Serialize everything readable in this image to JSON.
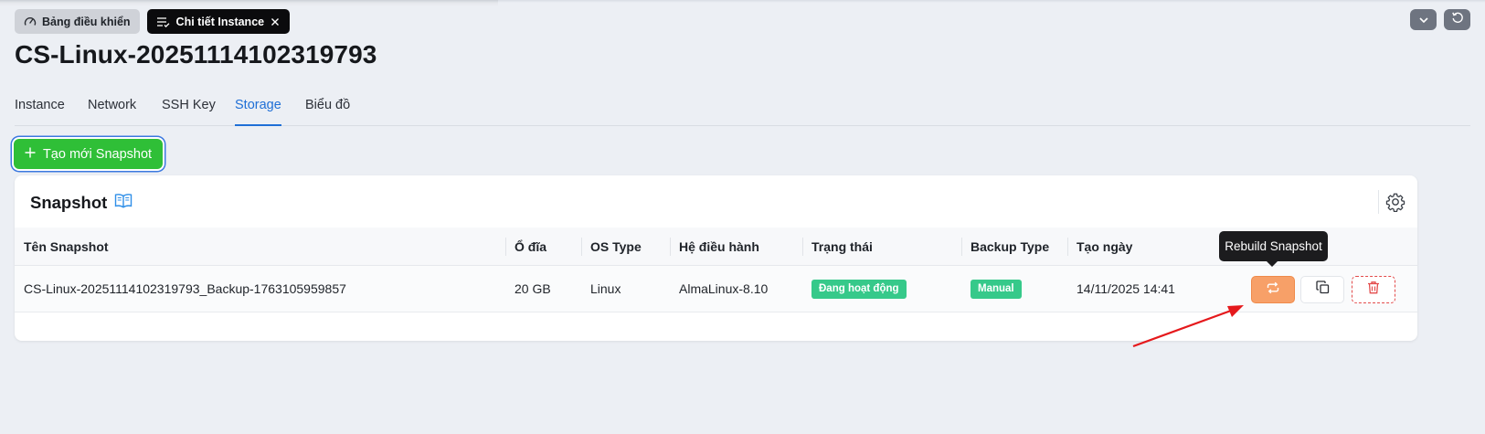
{
  "tabs": {
    "dashboard_label": "Bảng điều khiển",
    "detail_label": "Chi tiết Instance"
  },
  "page": {
    "title": "CS-Linux-20251114102319793"
  },
  "subtabs": {
    "instance": "Instance",
    "network": "Network",
    "ssh_key": "SSH Key",
    "storage": "Storage",
    "chart": "Biểu đồ",
    "active": "Storage"
  },
  "actions": {
    "create_snapshot": "Tạo mới Snapshot"
  },
  "card": {
    "title": "Snapshot"
  },
  "table": {
    "columns": {
      "name": "Tên Snapshot",
      "disk": "Ổ đĩa",
      "os_type": "OS Type",
      "os": "Hệ điều hành",
      "status": "Trạng thái",
      "backup_type": "Backup Type",
      "created": "Tạo ngày"
    },
    "rows": [
      {
        "name": "CS-Linux-20251114102319793_Backup-1763105959857",
        "disk": "20 GB",
        "os_type": "Linux",
        "os": "AlmaLinux-8.10",
        "status": "Đang hoạt động",
        "backup_type": "Manual",
        "created": "14/11/2025 14:41"
      }
    ]
  },
  "tooltip": {
    "rebuild": "Rebuild Snapshot"
  },
  "colors": {
    "primary": "#1f6fd6",
    "create_button": "#2fbf37",
    "status_badge": "#36c98a",
    "rebuild_button": "#f7a068",
    "delete": "#e34b4b",
    "annotation_arrow": "#e5191c"
  },
  "icons": {
    "dashboard": "gauge-icon",
    "detail": "list-check-icon",
    "close": "close-icon",
    "dropdown": "chevron-down-icon",
    "refresh": "refresh-icon",
    "plus": "plus-icon",
    "book": "book-icon",
    "settings": "gear-icon",
    "rebuild": "repeat-icon",
    "copy": "copy-icon",
    "delete": "trash-icon"
  }
}
